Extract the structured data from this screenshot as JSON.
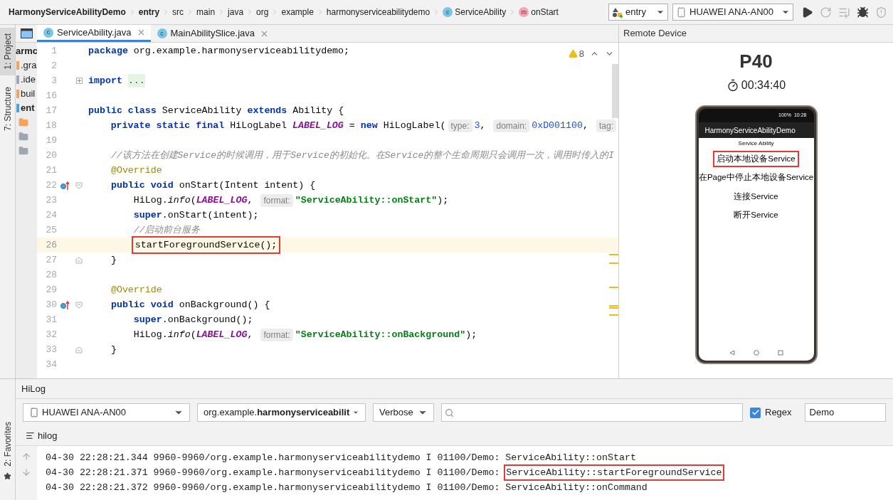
{
  "breadcrumbs": [
    {
      "label": "HarmonyServiceAbilityDemo",
      "bold": true
    },
    {
      "label": "entry",
      "bold": true
    },
    {
      "label": "src",
      "bold": false
    },
    {
      "label": "main",
      "bold": false
    },
    {
      "label": "java",
      "bold": false
    },
    {
      "label": "org",
      "bold": false
    },
    {
      "label": "example",
      "bold": false
    },
    {
      "label": "harmonyserviceabilitydemo",
      "bold": false
    },
    {
      "label": "ServiceAbility",
      "bold": false,
      "badge": {
        "kind": "class",
        "letter": "c"
      }
    },
    {
      "label": "onStart",
      "bold": false,
      "badge": {
        "kind": "method",
        "letter": "m"
      }
    }
  ],
  "run_config": "entry",
  "device": "HUAWEI ANA-AN00",
  "toolbar": [
    {
      "kind": "run",
      "disabled": false
    },
    {
      "kind": "rerun",
      "disabled": true
    },
    {
      "kind": "log",
      "disabled": true
    },
    {
      "kind": "debug",
      "disabled": false
    },
    {
      "kind": "attach",
      "disabled": true
    }
  ],
  "side_tabs": [
    {
      "label": "1: Project",
      "selected": true
    },
    {
      "label": "7: Structure",
      "selected": false
    }
  ],
  "project_tree": [
    {
      "label": "armc",
      "kind": "project"
    },
    {
      "label": ".gra",
      "kind": "orange"
    },
    {
      "label": ".ide",
      "kind": "gray"
    },
    {
      "label": "buil",
      "kind": "orange"
    },
    {
      "label": "ent",
      "kind": "module"
    },
    {
      "kind": "folder-orange"
    },
    {
      "kind": "folder"
    },
    {
      "kind": "folder"
    }
  ],
  "editor_tabs": [
    {
      "label": "ServiceAbility.java",
      "badge": "c",
      "selected": true
    },
    {
      "label": "MainAbilitySlice.java",
      "badge": "c",
      "selected": false
    }
  ],
  "warnings": "8",
  "code": [
    {
      "number": "1",
      "tokens": [
        {
          "kind": "keyword",
          "text": "package"
        },
        {
          "kind": "plain",
          "text": " org.example.harmonyserviceabilitydemo;"
        }
      ]
    },
    {
      "number": "2"
    },
    {
      "number": "3",
      "collapsed": true,
      "tokens": [
        {
          "kind": "keyword",
          "text": "import"
        },
        {
          "kind": "folded",
          "text": "..."
        }
      ]
    },
    {
      "number": "16"
    },
    {
      "number": "17",
      "tokens": [
        {
          "kind": "keyword",
          "text": "public class"
        },
        {
          "kind": "plain",
          "text": " ServiceAbility "
        },
        {
          "kind": "keyword",
          "text": "extends"
        },
        {
          "kind": "plain",
          "text": " Ability {"
        }
      ]
    },
    {
      "number": "18",
      "tokens": [
        {
          "kind": "keyword",
          "text": "    private static final"
        },
        {
          "kind": "plain",
          "text": " HiLogLabel "
        },
        {
          "kind": "constant",
          "text": "LABEL_LOG"
        },
        {
          "kind": "plain",
          "text": " = "
        },
        {
          "kind": "keyword",
          "text": "new"
        },
        {
          "kind": "plain",
          "text": " HiLogLabel("
        },
        {
          "kind": "hint",
          "text": "type:"
        },
        {
          "kind": "number",
          "text": "3"
        },
        {
          "kind": "plain",
          "text": ", "
        },
        {
          "kind": "hint",
          "text": "domain:"
        },
        {
          "kind": "number",
          "text": "0xD001100"
        },
        {
          "kind": "plain",
          "text": ", "
        },
        {
          "kind": "hint",
          "text": "tag:"
        }
      ]
    },
    {
      "number": "19"
    },
    {
      "number": "20",
      "tokens": [
        {
          "kind": "comment",
          "text": "    //该方法在创建Service的时候调用，用于Service的初始化。在Service的整个生命周期只会调用一次，调用时传入的I"
        }
      ]
    },
    {
      "number": "21",
      "tokens": [
        {
          "kind": "annotation",
          "text": "    @Override"
        }
      ]
    },
    {
      "number": "22",
      "override": true,
      "fold_start": true,
      "tokens": [
        {
          "kind": "keyword",
          "text": "    public void"
        },
        {
          "kind": "plain",
          "text": " onStart(Intent intent) {"
        }
      ]
    },
    {
      "number": "23",
      "tokens": [
        {
          "kind": "plain",
          "text": "        HiLog."
        },
        {
          "kind": "method",
          "text": "info"
        },
        {
          "kind": "plain",
          "text": "("
        },
        {
          "kind": "constant",
          "text": "LABEL_LOG"
        },
        {
          "kind": "plain",
          "text": ", "
        },
        {
          "kind": "hint",
          "text": "format:"
        },
        {
          "kind": "string",
          "text": "\"ServiceAbility::onStart\""
        },
        {
          "kind": "plain",
          "text": ");"
        }
      ]
    },
    {
      "number": "24",
      "tokens": [
        {
          "kind": "keyword",
          "text": "        super"
        },
        {
          "kind": "plain",
          "text": ".onStart(intent);"
        }
      ]
    },
    {
      "number": "25",
      "tokens": [
        {
          "kind": "comment",
          "text": "        //启动前台服务"
        }
      ]
    },
    {
      "number": "26",
      "current": true,
      "tokens": [
        {
          "kind": "plain",
          "text": "        startForegroundService();",
          "highlighted": true
        }
      ]
    },
    {
      "number": "27",
      "fold_end": true,
      "tokens": [
        {
          "kind": "plain",
          "text": "    }"
        }
      ]
    },
    {
      "number": "28"
    },
    {
      "number": "29",
      "tokens": [
        {
          "kind": "annotation",
          "text": "    @Override"
        }
      ]
    },
    {
      "number": "30",
      "override": true,
      "fold_start": true,
      "tokens": [
        {
          "kind": "keyword",
          "text": "    public void"
        },
        {
          "kind": "plain",
          "text": " onBackground() {"
        }
      ]
    },
    {
      "number": "31",
      "tokens": [
        {
          "kind": "keyword",
          "text": "        super"
        },
        {
          "kind": "plain",
          "text": ".onBackground();"
        }
      ]
    },
    {
      "number": "32",
      "tokens": [
        {
          "kind": "plain",
          "text": "        HiLog."
        },
        {
          "kind": "method",
          "text": "info"
        },
        {
          "kind": "plain",
          "text": "("
        },
        {
          "kind": "constant",
          "text": "LABEL_LOG"
        },
        {
          "kind": "plain",
          "text": ", "
        },
        {
          "kind": "hint",
          "text": "format:"
        },
        {
          "kind": "string",
          "text": "\"ServiceAbility::onBackground\""
        },
        {
          "kind": "plain",
          "text": ");"
        }
      ]
    },
    {
      "number": "33",
      "fold_end": true,
      "tokens": [
        {
          "kind": "plain",
          "text": "    }"
        }
      ]
    },
    {
      "number": "34"
    }
  ],
  "remote_device": {
    "title": "Remote Device",
    "model": "P40",
    "timer": "00:34:40",
    "phone": {
      "battery": "100%",
      "time": "10:28",
      "app_title": "HarmonyServiceAbilityDemo",
      "subtitle": "Service Ability",
      "buttons": [
        {
          "label": "启动本地设备Service",
          "highlighted": true
        },
        {
          "label": "在Page中停止本地设备Service",
          "highlighted": false
        },
        {
          "label": "连接Service",
          "highlighted": false
        },
        {
          "label": "断开Service",
          "highlighted": false
        }
      ]
    }
  },
  "hilog": {
    "title": "HiLog",
    "device": "HUAWEI ANA-AN00",
    "package": "org.example.**harmonyserviceabilit**",
    "level": "Verbose",
    "regex": {
      "label": "Regex",
      "checked": true
    },
    "filter": "Demo",
    "tab": "hilog",
    "lines": [
      {
        "prefix": "04-30 22:28:21.344 9960-9960/org.example.harmonyserviceabilitydemo I 01100/Demo:",
        "message": "ServiceAbility::onStart",
        "highlighted": false
      },
      {
        "prefix": "04-30 22:28:21.371 9960-9960/org.example.harmonyserviceabilitydemo I 01100/Demo:",
        "message": "ServiceAbility::startForegroundService",
        "highlighted": true
      },
      {
        "prefix": "04-30 22:28:21.372 9960-9960/org.example.harmonyserviceabilitydemo I 01100/Demo:",
        "message": "ServiceAbility::onCommand",
        "highlighted": false
      }
    ]
  },
  "bottom_side_tabs": [
    {
      "label": "2: Favorites",
      "selected": false
    }
  ]
}
